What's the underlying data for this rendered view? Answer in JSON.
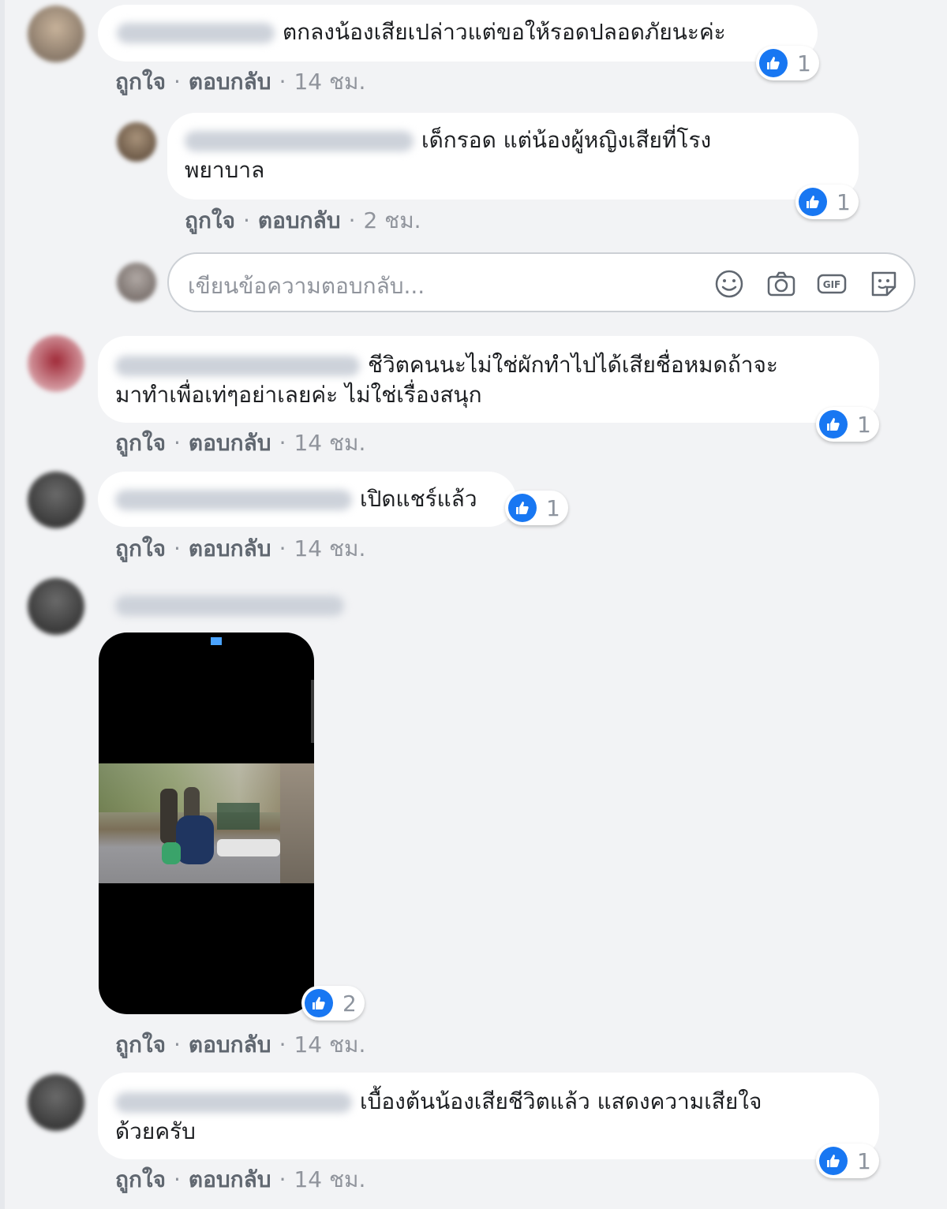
{
  "actions": {
    "like": "ถูกใจ",
    "reply": "ตอบกลับ",
    "separator": "·"
  },
  "reply_input": {
    "placeholder": "เขียนข้อความตอบกลับ..."
  },
  "icons": {
    "emoji": "smile-icon",
    "camera": "camera-icon",
    "gif": "gif-icon",
    "sticker": "sticker-icon",
    "like": "like-icon"
  },
  "colors": {
    "like_blue": "#1877f2",
    "bubble_bg": "#ffffff",
    "page_bg": "#f2f3f5"
  },
  "comments": [
    {
      "text": "ตกลงน้องเสียเปล่าวแต่ขอให้รอดปลอดภัยนะค่ะ",
      "reactions": "1",
      "time": "14 ชม."
    },
    {
      "text_line1": "เด็กรอด แต่น้องผู้หญิงเสียที่โรง",
      "text_line2": "พยาบาล",
      "reactions": "1",
      "time": "2 ชม."
    },
    {
      "text_line1": "ชีวิตคนนะไม่ใช่ผักทำไปได้เสียชื่อหมดถ้าจะ",
      "text_line2": "มาทำเพื่อเท่ๆอย่าเลยค่ะ ไม่ใช่เรื่องสนุก",
      "reactions": "1",
      "time": "14 ชม."
    },
    {
      "text": "เปิดแชร์แล้ว",
      "reactions": "1",
      "time": "14 ชม."
    },
    {
      "reactions": "2",
      "time": "14 ชม."
    },
    {
      "text_line1": "เบื้องต้นน้องเสียชีวิตแล้ว แสดงความเสียใจ",
      "text_line2": "ด้วยครับ",
      "reactions": "1",
      "time": "14 ชม."
    }
  ]
}
